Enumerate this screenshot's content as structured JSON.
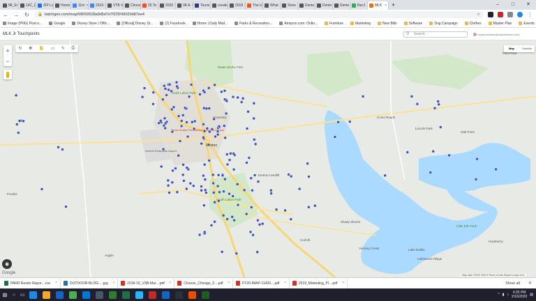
{
  "browser": {
    "tabs": [
      {
        "label": "88_Er",
        "icon": "page-icon",
        "color": "#555555"
      },
      {
        "label": "14C_D",
        "icon": "page-icon",
        "color": "#555555"
      },
      {
        "label": "ZIP Lo",
        "icon": "globe-icon",
        "color": "#1a73e8"
      },
      {
        "label": "Homo",
        "icon": "page-icon",
        "color": "#555555"
      },
      {
        "label": "11m",
        "icon": "globe-icon",
        "color": "#4285f4"
      },
      {
        "label": "2019",
        "icon": "globe-icon",
        "color": "#4285f4"
      },
      {
        "label": "VTB V",
        "icon": "page-icon",
        "color": "#555555"
      },
      {
        "label": "Choos",
        "icon": "page-icon",
        "color": "#555555"
      },
      {
        "label": "25 To",
        "icon": "page-icon",
        "color": "#f4511e"
      },
      {
        "label": "2020",
        "icon": "page-icon",
        "color": "#555555"
      },
      {
        "label": "08-A",
        "icon": "page-icon",
        "color": "#555555"
      },
      {
        "label": "Touris",
        "icon": "page-icon",
        "color": "#2e3a87"
      },
      {
        "label": "creativ",
        "icon": "page-icon",
        "color": "#555555"
      },
      {
        "label": "2018",
        "icon": "page-icon",
        "color": "#555555"
      },
      {
        "label": "The U",
        "icon": "page-icon",
        "color": "#f4511e"
      },
      {
        "label": "What",
        "icon": "page-icon",
        "color": "#555555"
      },
      {
        "label": "Store",
        "icon": "page-icon",
        "color": "#555555"
      },
      {
        "label": "Dente",
        "icon": "page-icon",
        "color": "#555555"
      },
      {
        "label": "Dente",
        "icon": "page-icon",
        "color": "#555555"
      },
      {
        "label": "Dente",
        "icon": "page-icon",
        "color": "#555555"
      },
      {
        "label": "Rec1",
        "icon": "page-icon",
        "color": "#34a853"
      },
      {
        "label": "MLK",
        "icon": "page-icon",
        "color": "#e8710a",
        "active": true
      }
    ],
    "new_tab": "+",
    "url": "batchgeo.com/map/58059528a9d5d7e7f22f249020d87ee4",
    "bookmarks": [
      "Image (PNG) Post o...",
      "Google",
      "Disney Store | Offic...",
      "[Official] Disney St...",
      "(2) Facebook",
      "Home | Daily Mail...",
      "Parks & Recreation...",
      "Amazon.com: Onlin...",
      "Furniture",
      "Marketing",
      "New Bills",
      "Software",
      "Dog Campaign",
      "Clothes",
      "Master Plan",
      "Events"
    ]
  },
  "app": {
    "title": "MLK Jr Touchpoints",
    "search_placeholder": "Search",
    "user_email": "maria.denison@cityofdenton.com",
    "map_types": [
      "Map",
      "Satellite"
    ],
    "zoom_in": "+",
    "zoom_out": "−",
    "google_logo": "Google",
    "attribution": "Map data ©2020   2000 ft   Terms of Use   Report a map error"
  },
  "map": {
    "labels": [
      "Water Works Park",
      "North Lakes Park",
      "University",
      "Texas Health Presbyterian Hospital Denton",
      "Denton Enterprise Airport",
      "Denton",
      "Denton Landfill",
      "South Lakes Park",
      "Corinth",
      "Shady Shores",
      "Hickory Creek",
      "Lake Dallas",
      "Little Elm Park",
      "Lincoln Park",
      "Cross Roads",
      "Oak Point",
      "Ponder",
      "Argyle",
      "Hackberry",
      "Lakewood Village",
      "Pilot Point"
    ],
    "marker_color": "#3f51b5"
  },
  "downloads": [
    {
      "name": "PARD Roster Repor....csv",
      "color": "#1e7145"
    },
    {
      "name": "OUTDOOR-BLOG-....jpg",
      "color": "#2a6f9e"
    },
    {
      "name": "2018-19_VSB-Mar....pdf",
      "color": "#d93025"
    },
    {
      "name": "Choose_Chicago_0....pdf",
      "color": "#d93025"
    },
    {
      "name": "FY20-IMAP-11420....pdf",
      "color": "#d93025"
    },
    {
      "name": "2019_Marketing_Pl....pdf",
      "color": "#d93025"
    }
  ],
  "downloads_show_all": "Show all",
  "taskbar": {
    "time": "4:25 PM",
    "date": "2/16/2020",
    "apps": [
      {
        "icon": "ie-icon",
        "color": "#1e88e5"
      },
      {
        "icon": "folder-icon",
        "color": "#f9a825"
      },
      {
        "icon": "edge-icon",
        "color": "#1565c0"
      },
      {
        "icon": "chrome-icon",
        "color": "#4caf50"
      },
      {
        "icon": "outlook-icon",
        "color": "#0078d4"
      },
      {
        "icon": "store-icon",
        "color": "#455a64"
      },
      {
        "icon": "mail-icon",
        "color": "#2e7d32"
      },
      {
        "icon": "excel-icon",
        "color": "#1e7145"
      },
      {
        "icon": "vscode-icon",
        "color": "#29b6f6"
      },
      {
        "icon": "acrobat-icon",
        "color": "#c62828"
      },
      {
        "icon": "photoshop-icon",
        "color": "#1565c0"
      },
      {
        "icon": "bridge-icon",
        "color": "#263238"
      },
      {
        "icon": "illustrator-icon",
        "color": "#e65100"
      },
      {
        "icon": "excel2-icon",
        "color": "#1b5e20"
      }
    ]
  }
}
